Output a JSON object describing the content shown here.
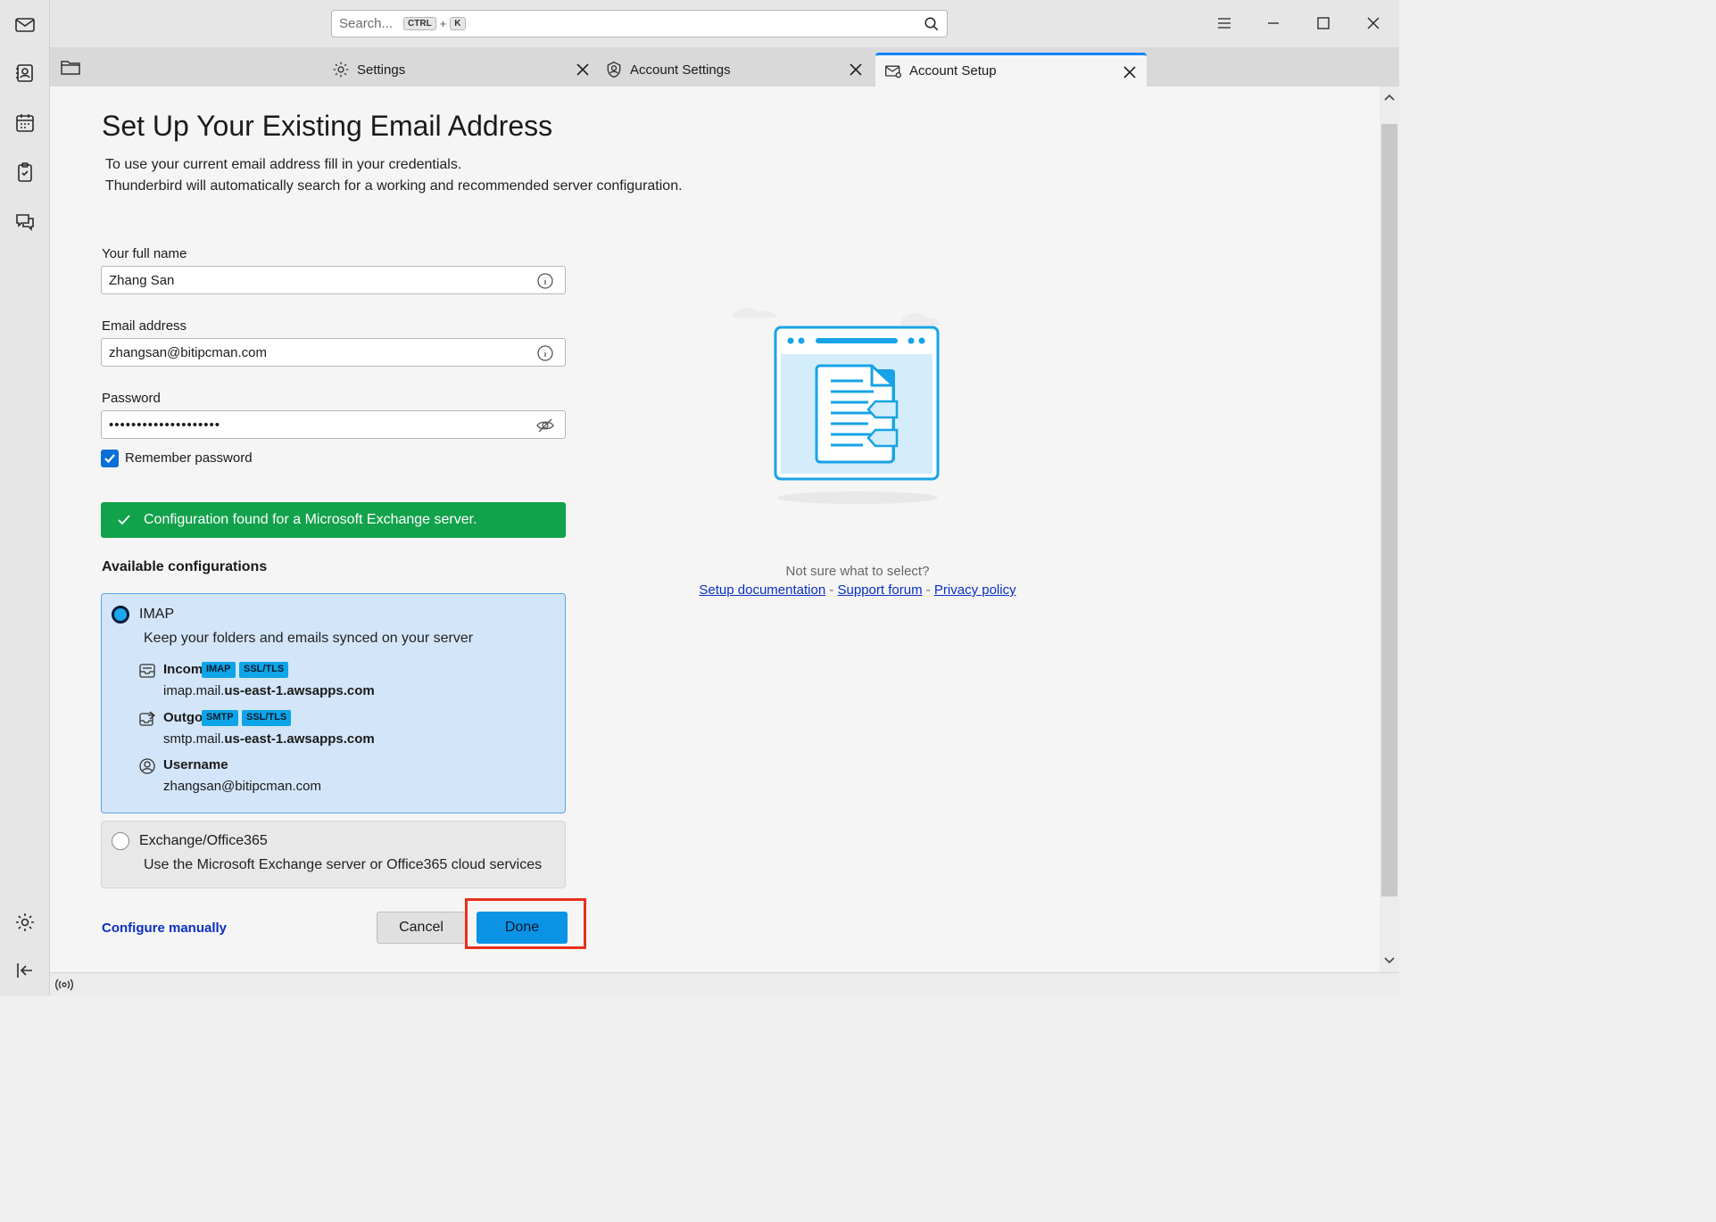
{
  "window": {
    "search_placeholder": "Search...",
    "search_shortcut_ctrl": "CTRL",
    "search_shortcut_plus": "+",
    "search_shortcut_key": "K"
  },
  "tabs": [
    {
      "label": "Settings",
      "icon": "gear-icon"
    },
    {
      "label": "Account Settings",
      "icon": "account-icon"
    },
    {
      "label": "Account Setup",
      "icon": "mail-settings-icon"
    }
  ],
  "page": {
    "title": "Set Up Your Existing Email Address",
    "subtitle_line1": "To use your current email address fill in your credentials.",
    "subtitle_line2": "Thunderbird will automatically search for a working and recommended server configuration."
  },
  "form": {
    "name_label": "Your full name",
    "name_value": "Zhang San",
    "email_label": "Email address",
    "email_value": "zhangsan@bitipcman.com",
    "password_label": "Password",
    "password_value": "••••••••••••••••••••",
    "remember_label": "Remember password",
    "remember_checked": true
  },
  "status": {
    "found_message": "Configuration found for a Microsoft Exchange server."
  },
  "configs": {
    "section_title": "Available configurations",
    "imap": {
      "title": "IMAP",
      "description": "Keep your folders and emails synced on your server",
      "incoming_label": "Incoming",
      "incoming_badge1": "IMAP",
      "incoming_badge2": "SSL/TLS",
      "incoming_host_prefix": "imap.mail.",
      "incoming_host_domain": "us-east-1.awsapps.com",
      "outgoing_label": "Outgoing",
      "outgoing_badge1": "SMTP",
      "outgoing_badge2": "SSL/TLS",
      "outgoing_host_prefix": "smtp.mail.",
      "outgoing_host_domain": "us-east-1.awsapps.com",
      "username_label": "Username",
      "username_value": "zhangsan@bitipcman.com"
    },
    "exchange": {
      "title": "Exchange/Office365",
      "description": "Use the Microsoft Exchange server or Office365 cloud services"
    }
  },
  "actions": {
    "configure_manually": "Configure manually",
    "cancel": "Cancel",
    "done": "Done"
  },
  "help": {
    "question": "Not sure what to select?",
    "setup_docs": "Setup documentation",
    "separator": "-",
    "support_forum": "Support forum",
    "privacy_policy": "Privacy policy"
  },
  "colors": {
    "accent": "#0b93e6",
    "success": "#12a24b",
    "selected_card": "#d3e5f8",
    "highlight": "#e8311b"
  }
}
